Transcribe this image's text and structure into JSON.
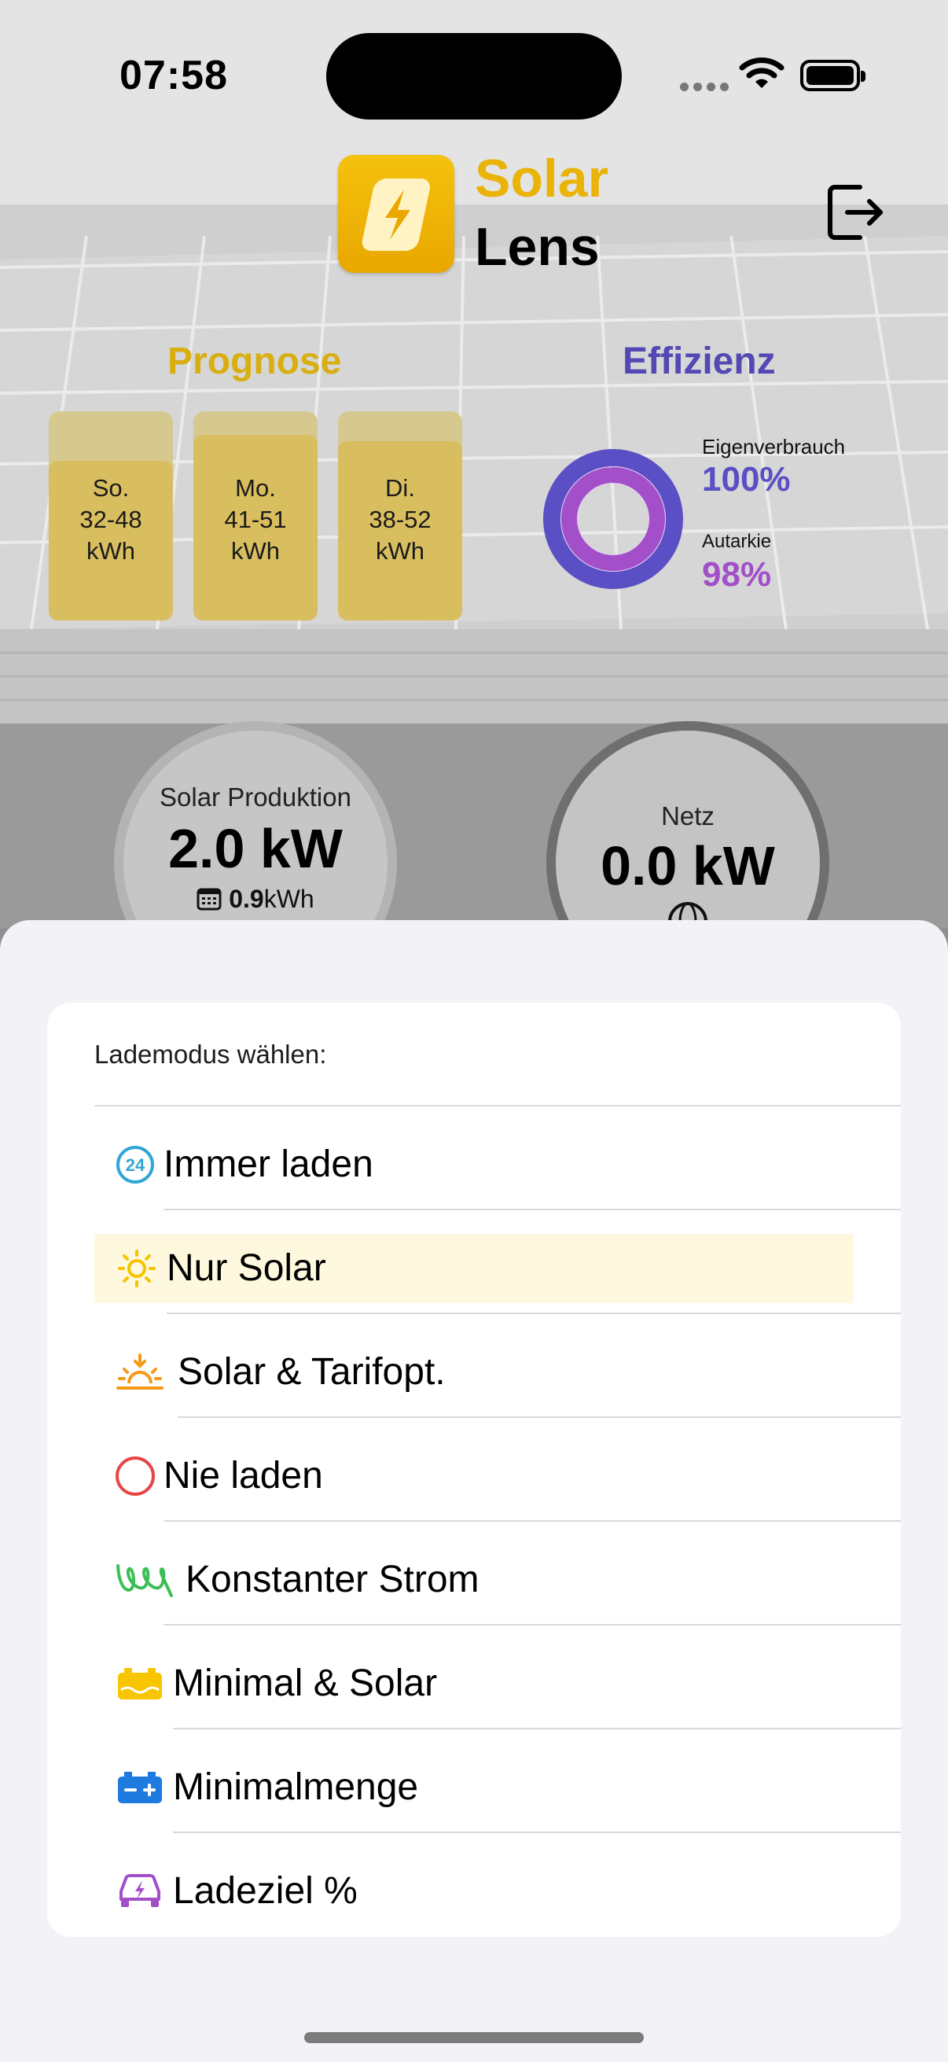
{
  "status": {
    "time": "07:58"
  },
  "header": {
    "brand_top": "Solar",
    "brand_bottom": "Lens"
  },
  "forecast": {
    "title": "Prognose",
    "days": [
      {
        "day": "So.",
        "range": "32-48",
        "unit": "kWh"
      },
      {
        "day": "Mo.",
        "range": "41-51",
        "unit": "kWh"
      },
      {
        "day": "Di.",
        "range": "38-52",
        "unit": "kWh"
      }
    ]
  },
  "efficiency": {
    "title": "Effizienz",
    "self_consumption_label": "Eigenverbrauch",
    "self_consumption_value": "100%",
    "autarky_label": "Autarkie",
    "autarky_value": "98%",
    "colors": {
      "self_consumption": "#5a4fc4",
      "autarky": "#a24fc9"
    }
  },
  "gauges": {
    "solar": {
      "label": "Solar Produktion",
      "value": "2.0 kW",
      "energy_value": "0.9",
      "energy_unit": "kWh"
    },
    "grid": {
      "label": "Netz",
      "value": "0.0 kW"
    }
  },
  "charge_mode": {
    "title": "Lademodus wählen:",
    "selected_index": 1,
    "options": [
      {
        "label": "Immer laden",
        "icon": "24-hours-icon",
        "color": "#30a6d6"
      },
      {
        "label": "Nur Solar",
        "icon": "sun-icon",
        "color": "#f5c400"
      },
      {
        "label": "Solar & Tarifopt.",
        "icon": "sunrise-icon",
        "color": "#f59a16"
      },
      {
        "label": "Nie laden",
        "icon": "circle-icon",
        "color": "#e84545"
      },
      {
        "label": "Konstanter Strom",
        "icon": "coil-icon",
        "color": "#3bbf55"
      },
      {
        "label": "Minimal & Solar",
        "icon": "battery-solar-icon",
        "color": "#f7c600"
      },
      {
        "label": "Minimalmenge",
        "icon": "battery-icon",
        "color": "#1f7ae0"
      },
      {
        "label": "Ladeziel %",
        "icon": "car-bolt-icon",
        "color": "#a24fc9"
      }
    ]
  }
}
